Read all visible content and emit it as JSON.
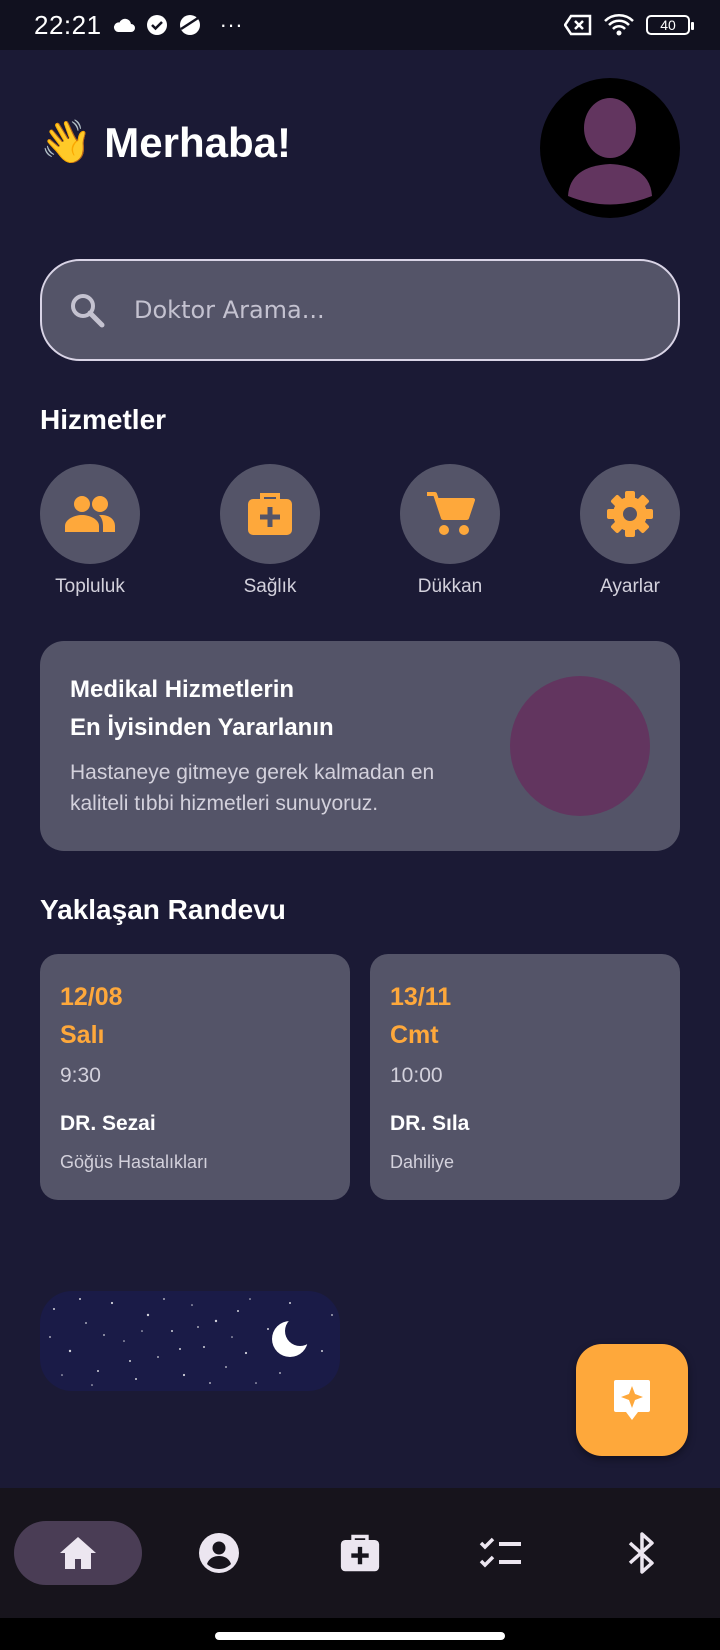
{
  "status_bar": {
    "time": "22:21",
    "more": "···",
    "battery": "40"
  },
  "header": {
    "wave_emoji": "👋",
    "greeting": "Merhaba!"
  },
  "search": {
    "placeholder": "Doktor Arama..."
  },
  "services": {
    "title": "Hizmetler",
    "items": [
      {
        "label": "Topluluk",
        "icon": "group-icon"
      },
      {
        "label": "Sağlık",
        "icon": "medical-bag-icon"
      },
      {
        "label": "Dükkan",
        "icon": "cart-icon"
      },
      {
        "label": "Ayarlar",
        "icon": "gear-icon"
      }
    ]
  },
  "promo": {
    "title_line1": "Medikal Hizmetlerin",
    "title_line2": "En İyisinden Yararlanın",
    "text": "Hastaneye gitmeye gerek kalmadan en kaliteli tıbbi hizmetleri sunuyoruz."
  },
  "appointments": {
    "title": "Yaklaşan Randevu",
    "items": [
      {
        "date": "12/08",
        "day": "Salı",
        "time": "9:30",
        "doctor": "DR. Sezai",
        "department": "Göğüs Hastalıkları"
      },
      {
        "date": "13/11",
        "day": "Cmt",
        "time": "10:00",
        "doctor": "DR. Sıla",
        "department": "Dahiliye"
      }
    ]
  },
  "bottom_nav": {
    "items": [
      "home-icon",
      "account-icon",
      "medical-bag-icon",
      "checklist-icon",
      "bluetooth-icon"
    ],
    "active": "home-icon"
  },
  "colors": {
    "background": "#1b1a35",
    "card": "#545468",
    "accent": "#fea83b",
    "avatar_purple": "#62355f"
  }
}
